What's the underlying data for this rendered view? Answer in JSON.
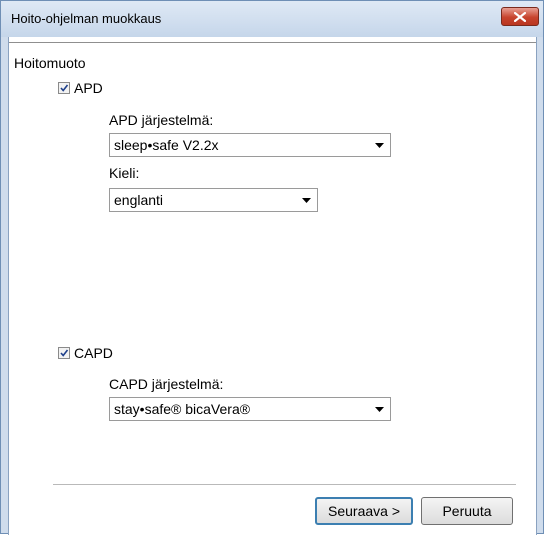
{
  "window": {
    "title": "Hoito-ohjelman muokkaus"
  },
  "group": {
    "label": "Hoitomuoto"
  },
  "apd": {
    "checkbox_label": "APD",
    "checked": true,
    "system_label": "APD järjestelmä:",
    "system_value": "sleep•safe V2.2x",
    "language_label": "Kieli:",
    "language_value": "englanti"
  },
  "capd": {
    "checkbox_label": "CAPD",
    "checked": true,
    "system_label": "CAPD järjestelmä:",
    "system_value": "stay•safe® bicaVera®"
  },
  "buttons": {
    "next": "Seuraava >",
    "cancel": "Peruuta"
  },
  "colors": {
    "close_button": "#c7442d",
    "default_button_border": "#3c7fb1",
    "titlebar": "#c5d6ea"
  },
  "icons": {
    "close": "close-icon",
    "dropdown": "chevron-down-icon",
    "checkmark": "check-icon"
  }
}
